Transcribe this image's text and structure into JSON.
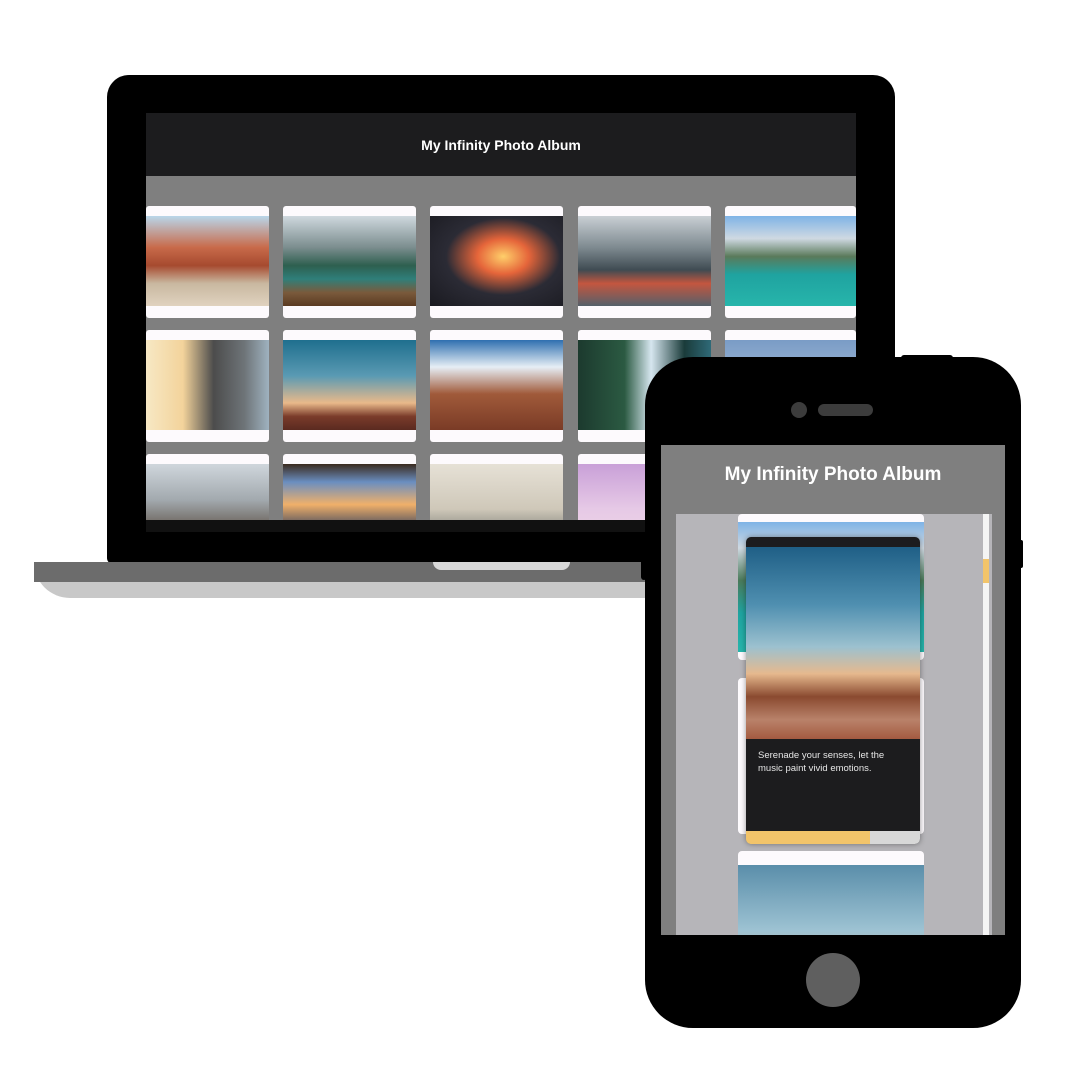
{
  "laptop": {
    "header_title": "My Infinity Photo Album",
    "photos": [
      {
        "name": "canyon-road-van",
        "grad": "linear-gradient(180deg,#b9d6ea 0%,#c86a4a 35%,#a64a2f 55%,#c9b8a0 75%,#e0d2bf 100%)"
      },
      {
        "name": "lake-boat-mountains",
        "grad": "linear-gradient(180deg,#cfd8de 0%,#7b8d8e 35%,#2e5f4f 55%,#2f7f7a 70%,#7a5a3c 85%,#5b3b22 100%)"
      },
      {
        "name": "airplane-window-sunset",
        "grad": "radial-gradient(ellipse at 55% 45%,#ffcf6a 0%,#e5653a 25%,#2b2b35 55%,#1a1a20 100%)"
      },
      {
        "name": "hiker-backpack-lake",
        "grad": "linear-gradient(180deg,#c9cfd4 0%,#7e8a90 35%,#3f4b52 60%,#c4563f 75%,#55606a 100%)"
      },
      {
        "name": "turquoise-lake-boat",
        "grad": "linear-gradient(180deg,#7fb3e6 0%,#cfd9e2 25%,#5a7a5a 45%,#1fa3a0 65%,#27b5ab 100%)"
      },
      {
        "name": "airport-traveler",
        "grad": "linear-gradient(90deg,#f7e8c4 0%,#f3d39b 30%,#4c4c4c 55%,#6e7478 80%,#9fb2bf 100%)"
      },
      {
        "name": "desert-sunset-sitter",
        "grad": "linear-gradient(180deg,#1f6f8e 0%,#5a9ab3 40%,#e9b98a 70%,#7a3b2a 85%,#5a2a20 100%)"
      },
      {
        "name": "canyon-sunburst",
        "grad": "linear-gradient(180deg,#2f6fb0 0%,#e6eef5 30%,#a05a3a 60%,#7a3b26 100%)"
      },
      {
        "name": "waterfall-forest",
        "grad": "linear-gradient(90deg,#1c3a2e 0%,#2b5a42 35%,#d6e6ef 55%,#1a3b3a 80%,#2f6a78 100%)"
      },
      {
        "name": "cropped-sky",
        "grad": "linear-gradient(180deg,#7a9cc6 0%,#c9d6e6 100%)"
      },
      {
        "name": "rocky-horizon",
        "grad": "linear-gradient(180deg,#cfd6dc 0%,#a2a9ae 40%,#6b625a 70%,#3b342f 100%)"
      },
      {
        "name": "window-silhouette-sunset",
        "grad": "linear-gradient(180deg,#3a2a1e 0%,#6a8ec0 20%,#f0b06a 45%,#2a3a5a 75%,#1a1a1a 100%)"
      },
      {
        "name": "misty-mountains",
        "grad": "linear-gradient(180deg,#e6e1d6 0%,#cfc8b9 50%,#8a8a82 75%,#5a5a55 100%)"
      },
      {
        "name": "purple-skyline",
        "grad": "linear-gradient(180deg,#c9a0d8 0%,#e6c9e6 50%,#f2dbe8 100%)"
      }
    ]
  },
  "phone": {
    "header_title": "My Infinity Photo Album",
    "focus_caption": "Serenade your senses, let the music paint vivid emotions.",
    "focus_photo_grad": "linear-gradient(180deg,#1f5f86 0%,#4f8fb0 30%,#9cc1cf 52%,#e6b98e 66%,#8a4a30 78%,#b9826a 90%,#a45a40 100%)",
    "bg_photo_top_grad": "linear-gradient(180deg,#7fb3e6 0%,#cfd9e2 20%,#4a7a5a 45%,#1fa3a0 70%,#27b5ab 100%)",
    "bg_photo_bottom_grad": "linear-gradient(180deg,#5a8eaa 0%,#9ec3d3 60%,#c9a98a 100%)",
    "progress": 0.71
  }
}
